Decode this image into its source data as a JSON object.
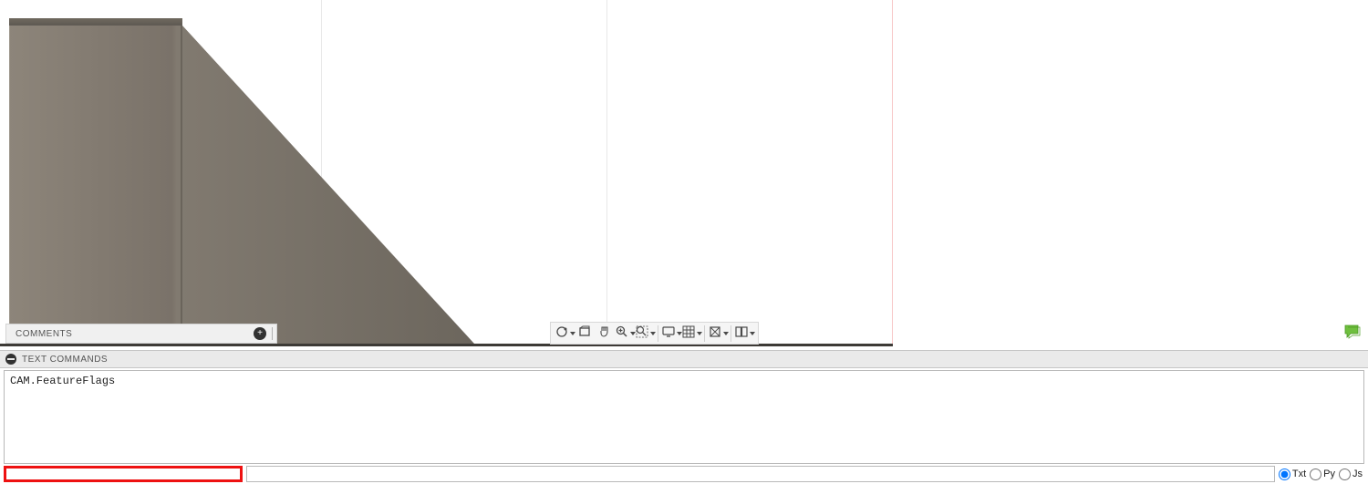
{
  "comments": {
    "label": "COMMENTS"
  },
  "nav_toolbar": {
    "items": [
      {
        "name": "orbit-icon"
      },
      {
        "name": "look-at-icon"
      },
      {
        "name": "pan-icon"
      },
      {
        "name": "zoom-icon"
      },
      {
        "name": "zoom-window-icon"
      },
      {
        "name": "display-settings-icon"
      },
      {
        "name": "grid-settings-icon"
      },
      {
        "name": "snap-icon"
      },
      {
        "name": "viewport-layout-icon"
      }
    ]
  },
  "text_commands": {
    "title": "TEXT COMMANDS",
    "output": "CAM.FeatureFlags",
    "input_value": "",
    "languages": {
      "txt": "Txt",
      "py": "Py",
      "js": "Js",
      "selected": "txt"
    }
  }
}
